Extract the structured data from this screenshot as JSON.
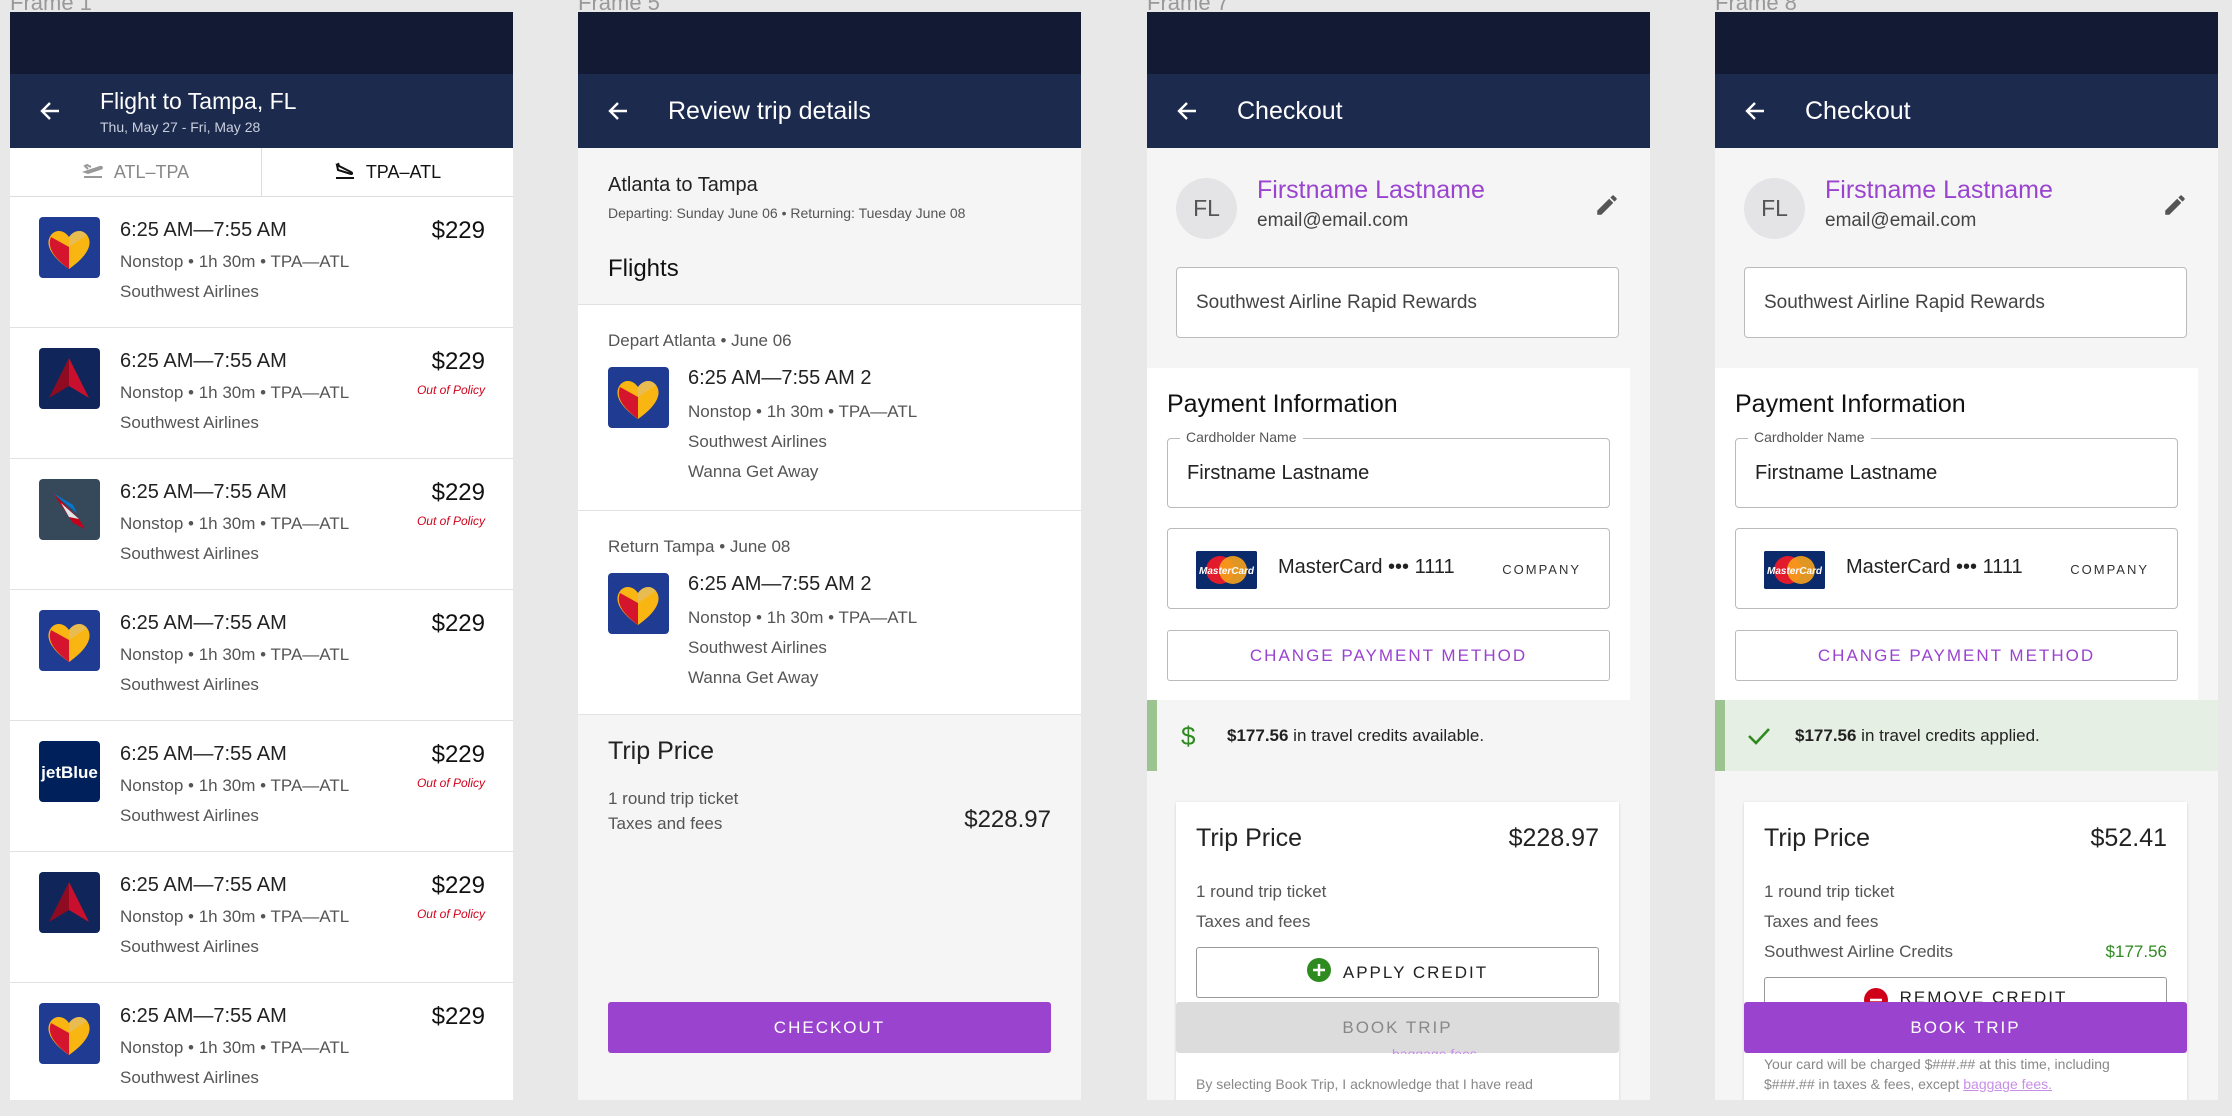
{
  "frames": [
    "Frame 1",
    "Frame 5",
    "Frame 7",
    "Frame 8"
  ],
  "f1": {
    "title": "Flight to Tampa, FL",
    "subtitle": "Thu, May 27 - Fri, May 28",
    "tab_out": "ATL–TPA",
    "tab_ret": "TPA–ATL",
    "rows": [
      {
        "times": "6:25 AM—7:55 AM",
        "meta": "Nonstop • 1h 30m • TPA—ATL",
        "airline": "Southwest Airlines",
        "price": "$229",
        "policy": "",
        "logo": "southwest"
      },
      {
        "times": "6:25 AM—7:55 AM",
        "meta": "Nonstop • 1h 30m • TPA—ATL",
        "airline": "Southwest Airlines",
        "price": "$229",
        "policy": "Out of Policy",
        "logo": "delta"
      },
      {
        "times": "6:25 AM—7:55 AM",
        "meta": "Nonstop • 1h 30m • TPA—ATL",
        "airline": "Southwest Airlines",
        "price": "$229",
        "policy": "Out of Policy",
        "logo": "american"
      },
      {
        "times": "6:25 AM—7:55 AM",
        "meta": "Nonstop • 1h 30m • TPA—ATL",
        "airline": "Southwest Airlines",
        "price": "$229",
        "policy": "",
        "logo": "southwest"
      },
      {
        "times": "6:25 AM—7:55 AM",
        "meta": "Nonstop • 1h 30m • TPA—ATL",
        "airline": "Southwest Airlines",
        "price": "$229",
        "policy": "Out of Policy",
        "logo": "jetblue"
      },
      {
        "times": "6:25 AM—7:55 AM",
        "meta": "Nonstop • 1h 30m • TPA—ATL",
        "airline": "Southwest Airlines",
        "price": "$229",
        "policy": "Out of Policy",
        "logo": "delta"
      },
      {
        "times": "6:25 AM—7:55 AM",
        "meta": "Nonstop • 1h 30m • TPA—ATL",
        "airline": "Southwest Airlines",
        "price": "$229",
        "policy": "",
        "logo": "southwest"
      }
    ]
  },
  "f2": {
    "title": "Review trip details",
    "route": "Atlanta to Tampa",
    "dates": "Departing: Sunday June 06 • Returning: Tuesday June 08",
    "flights_heading": "Flights",
    "segments": [
      {
        "head": "Depart Atlanta • June 06",
        "times": "6:25 AM—7:55 AM 2",
        "meta": "Nonstop • 1h 30m • TPA—ATL",
        "airline": "Southwest Airlines",
        "fare": "Wanna Get Away"
      },
      {
        "head": "Return Tampa • June 08",
        "times": "6:25 AM—7:55 AM 2",
        "meta": "Nonstop • 1h 30m • TPA—ATL",
        "airline": "Southwest Airlines",
        "fare": "Wanna Get Away"
      }
    ],
    "price_heading": "Trip Price",
    "ticket": "1 round trip ticket",
    "taxes": "Taxes and fees",
    "amount": "$228.97",
    "checkout": "CHECKOUT"
  },
  "f3": {
    "title": "Checkout",
    "initials": "FL",
    "name": "Firstname Lastname",
    "email": "email@email.com",
    "rewards": "Southwest Airline Rapid Rewards",
    "payment_heading": "Payment Information",
    "cardholder_label": "Cardholder Name",
    "cardholder": "Firstname Lastname",
    "card": "MasterCard ••• 1111",
    "company": "COMPANY",
    "mc_text": "MasterCard",
    "change": "CHANGE PAYMENT METHOD",
    "credit_amount": "$177.56",
    "credit_text": " in travel credits available.",
    "price_heading": "Trip Price",
    "amount": "$228.97",
    "ticket": "1 round trip ticket",
    "taxes": "Taxes and fees",
    "apply": "APPLY CREDIT",
    "book": "BOOK TRIP",
    "fine1": "baggage fees.",
    "fine2": "By selecting Book Trip, I acknowledge that I have read"
  },
  "f4": {
    "title": "Checkout",
    "initials": "FL",
    "name": "Firstname Lastname",
    "email": "email@email.com",
    "rewards": "Southwest Airline Rapid Rewards",
    "payment_heading": "Payment Information",
    "cardholder_label": "Cardholder Name",
    "cardholder": "Firstname Lastname",
    "card": "MasterCard ••• 1111",
    "company": "COMPANY",
    "mc_text": "MasterCard",
    "change": "CHANGE PAYMENT METHOD",
    "credit_amount": "$177.56",
    "credit_text": " in travel credits applied.",
    "price_heading": "Trip Price",
    "amount": "$52.41",
    "ticket": "1 round trip ticket",
    "taxes": "Taxes and fees",
    "credits_label": "Southwest Airline Credits",
    "credits_value": "$177.56",
    "remove": "REMOVE CREDIT",
    "book": "BOOK TRIP",
    "fine1": "Your card will be charged $###.## at this time, including",
    "fine2a": "$###.## in taxes & fees, except ",
    "fine2b": "baggage fees."
  },
  "colors": {
    "accent": "#9a43cf",
    "navy": "#1c2a4e",
    "status": "#131a33",
    "policy": "#d0021b",
    "credit_green": "#2e8b1f"
  }
}
